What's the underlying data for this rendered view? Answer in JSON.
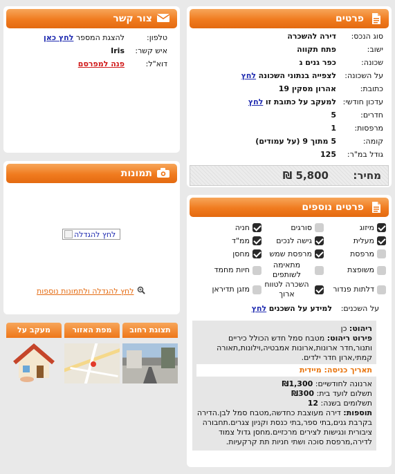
{
  "details": {
    "title": "פרטים",
    "rows": [
      {
        "label": "סוג הנכס:",
        "value": "דירה להשכרה"
      },
      {
        "label": "ישוב:",
        "value": "פתח תקווה"
      },
      {
        "label": "שכונה:",
        "value": "כפר גנים ג"
      },
      {
        "label": "על השכונה:",
        "value": "לצפייה בנתוני השכונה",
        "link": "לחץ"
      },
      {
        "label": "כתובת:",
        "value": "אהרון מסקין 19"
      },
      {
        "label": "עדכון חודשי:",
        "value": "למעקב על כתובת זו",
        "link": "לחץ"
      },
      {
        "label": "חדרים:",
        "value": "5"
      },
      {
        "label": "מרפסות:",
        "value": "1"
      },
      {
        "label": "קומה:",
        "value": "5 מתוך 9 (על עמודים)"
      },
      {
        "label": "גודל במ\"ר:",
        "value": "125"
      }
    ],
    "price_label": "מחיר:",
    "price_value": "5,800 ₪"
  },
  "contact": {
    "title": "צור קשר",
    "phone_label": "טלפון:",
    "phone_text": "להצגת המספר",
    "phone_link": "לחץ כאן",
    "person_label": "איש קשר:",
    "person_value": "Iris",
    "email_label": "דוא\"ל:",
    "email_link": "פנה למפרסם"
  },
  "photos": {
    "title": "תמונות",
    "enlarge_img_alt": "לחץ להגדלה",
    "more_link": "לחץ להגדלה ולתמונות נוספות"
  },
  "extra": {
    "title": "פרטים נוספים",
    "features": [
      {
        "label": "מיזוג",
        "checked": true
      },
      {
        "label": "סורגים",
        "checked": false
      },
      {
        "label": "חניה",
        "checked": true
      },
      {
        "label": "מעלית",
        "checked": true
      },
      {
        "label": "גישה לנכים",
        "checked": true
      },
      {
        "label": "ממ\"ד",
        "checked": true
      },
      {
        "label": "מרפסת",
        "checked": false
      },
      {
        "label": "מרפסת שמש",
        "checked": true
      },
      {
        "label": "מחסן",
        "checked": true
      },
      {
        "label": "משופצת",
        "checked": false
      },
      {
        "label": "מתאימה לשותפים",
        "checked": false
      },
      {
        "label": "חיות מחמד",
        "checked": false
      },
      {
        "label": "דלתות פנדור",
        "checked": false
      },
      {
        "label": "השכרה לטווח ארוך",
        "checked": true
      },
      {
        "label": "מזגן תדיראן",
        "checked": false
      }
    ],
    "tenants_label": "על השכנים:",
    "tenants_value": "למידע על השכנים",
    "tenants_link": "לחץ"
  },
  "info": {
    "furnish_label": "ריהוט:",
    "furnish_value": "כן",
    "furnish_detail_label": "פירוט ריהוט:",
    "furnish_detail_value": "מטבח סמל חדש הכולל כיריים ותנור,חדר ארונות,ארונות אמבטיה,וילונות,תאורה קמתי,ארון חדר ילדים.",
    "entry_label": "תאריך כניסה:",
    "entry_value": "מיידית",
    "arnona_label": "ארנונה לחודשיים:",
    "arnona_value": "₪1,300",
    "vaad_label": "תשלום לועד בית:",
    "vaad_value": "₪300",
    "payments_label": "תשלומים בשנה:",
    "payments_value": "12",
    "additions_label": "תוספות:",
    "additions_value": "דירה מעוצבת כחדשה,מטבח סמל לבן.הדירה בקרבת גנים,בתי ספר,בתי כנסת וקניון צגרים.תחבורה ציבורית ונגישות לצירים מרכזיים.מחסן גדול צמוד לדירה,מרפסת סוכה ושתי חניות תת קרקעיות."
  },
  "tiles": [
    {
      "title": "תצוגת רחוב"
    },
    {
      "title": "מפת האזור"
    },
    {
      "title": "מעקב על הבניין"
    }
  ]
}
